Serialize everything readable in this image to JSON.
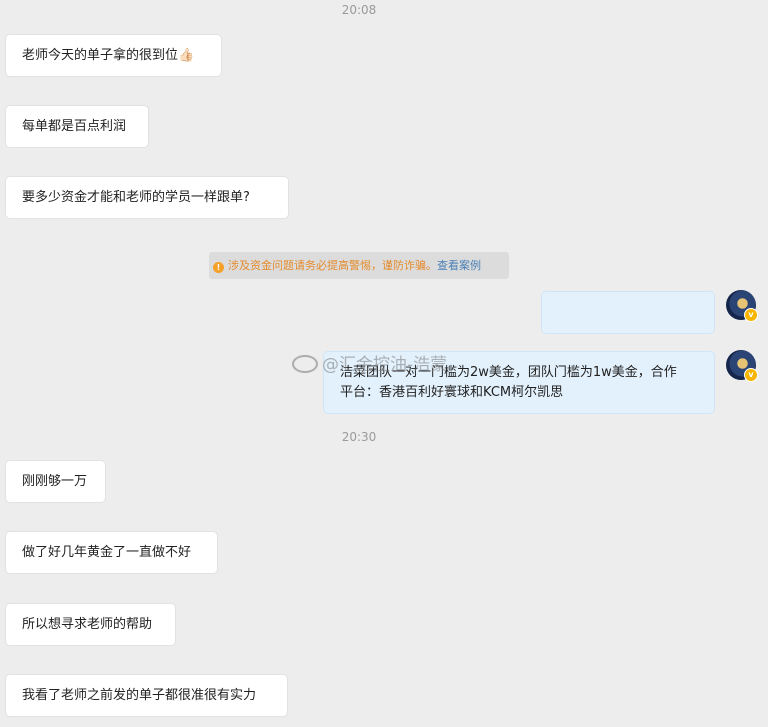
{
  "timestamps": [
    "20:08",
    "20:30"
  ],
  "messages_before": [
    "老师今天的单子拿的很到位👍🏻",
    "每单都是百点利润",
    "要多少资金才能和老师的学员一样跟单?"
  ],
  "notice": {
    "icon": "warning-icon",
    "text": "涉及资金问题请务必提高警惕，谨防诈骗。",
    "link": "查看案例"
  },
  "outgoing": {
    "line1": "洁菜团队一对一门槛为2w美金，团队门槛为1w美金，合作",
    "line2": "平台：香港百利好寰球和KCM柯尔凯思"
  },
  "watermark": "@汇金控油-浩蒙",
  "messages_after": [
    "刚刚够一万",
    "做了好几年黄金了一直做不好",
    "所以想寻求老师的帮助",
    "我看了老师之前发的单子都很准很有实力"
  ],
  "colors": {
    "incoming_bg": "#ffffff",
    "outgoing_bg": "#e3f1fc",
    "page_bg": "#ededed"
  }
}
